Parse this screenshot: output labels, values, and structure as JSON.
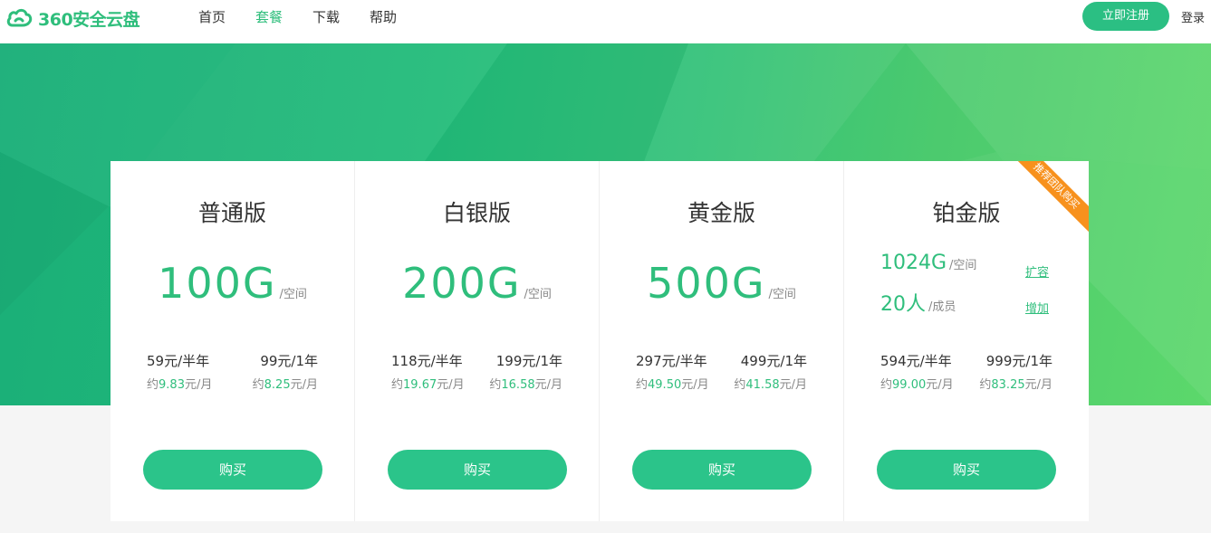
{
  "header": {
    "logo_text": "360安全云盘",
    "nav": [
      {
        "label": "首页",
        "active": false
      },
      {
        "label": "套餐",
        "active": true
      },
      {
        "label": "下载",
        "active": false
      },
      {
        "label": "帮助",
        "active": false
      }
    ],
    "register_label": "立即注册",
    "login_label": "登录"
  },
  "colors": {
    "accent": "#2fbe7c",
    "button": "#2bc48a",
    "ribbon": "#f7911d"
  },
  "plans": [
    {
      "title": "普通版",
      "space": "100G",
      "space_unit": "/空间",
      "price_half": "59元/半年",
      "price_year": "99元/1年",
      "per_half_prefix": "约",
      "per_half_value": "9.83",
      "per_half_suffix": "元/月",
      "per_year_prefix": "约",
      "per_year_value": "8.25",
      "per_year_suffix": "元/月",
      "buy_label": "购买"
    },
    {
      "title": "白银版",
      "space": "200G",
      "space_unit": "/空间",
      "price_half": "118元/半年",
      "price_year": "199元/1年",
      "per_half_prefix": "约",
      "per_half_value": "19.67",
      "per_half_suffix": "元/月",
      "per_year_prefix": "约",
      "per_year_value": "16.58",
      "per_year_suffix": "元/月",
      "buy_label": "购买"
    },
    {
      "title": "黄金版",
      "space": "500G",
      "space_unit": "/空间",
      "price_half": "297元/半年",
      "price_year": "499元/1年",
      "per_half_prefix": "约",
      "per_half_value": "49.50",
      "per_half_suffix": "元/月",
      "per_year_prefix": "约",
      "per_year_value": "41.58",
      "per_year_suffix": "元/月",
      "buy_label": "购买"
    },
    {
      "title": "铂金版",
      "space": "1024G",
      "space_unit": "/空间",
      "space_link": "扩容",
      "members": "20人",
      "members_unit": "/成员",
      "members_link": "增加",
      "ribbon": "推荐团队购买",
      "price_half": "594元/半年",
      "price_year": "999元/1年",
      "per_half_prefix": "约",
      "per_half_value": "99.00",
      "per_half_suffix": "元/月",
      "per_year_prefix": "约",
      "per_year_value": "83.25",
      "per_year_suffix": "元/月",
      "buy_label": "购买"
    }
  ]
}
